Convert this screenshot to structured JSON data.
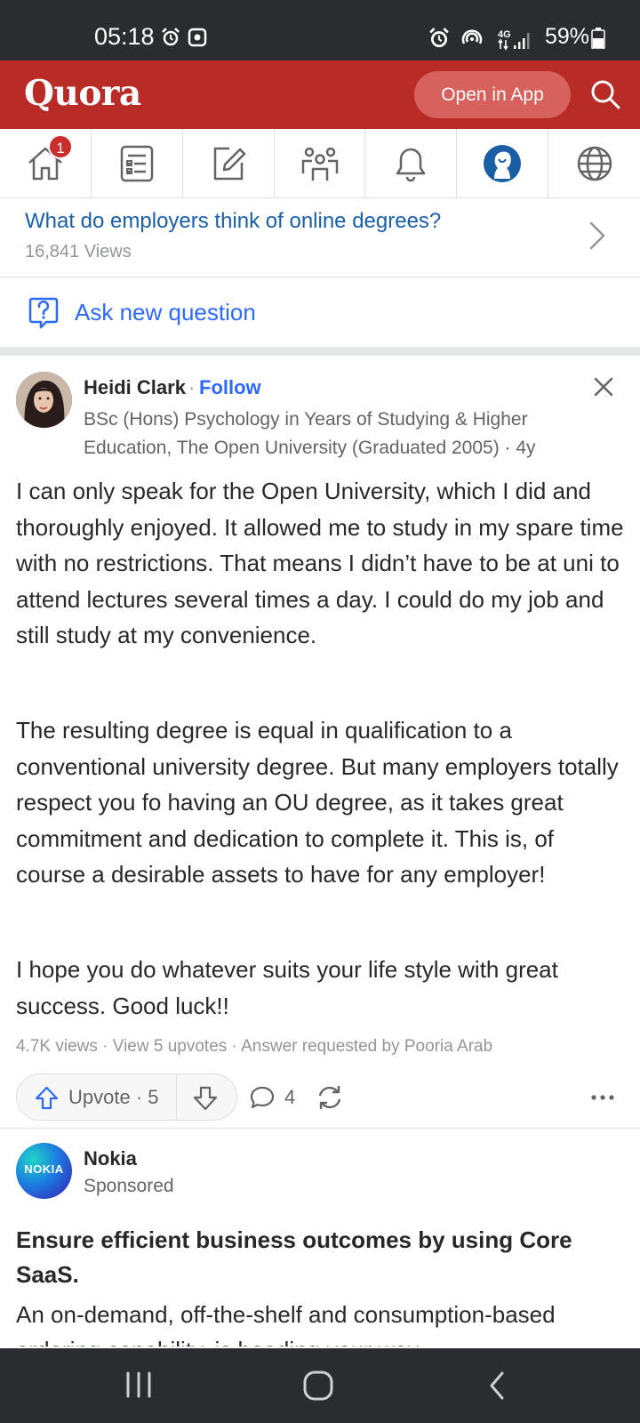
{
  "status_bar": {
    "time": "05:18",
    "battery": "59%",
    "network": "4G"
  },
  "header": {
    "logo": "Quora",
    "open_in_app": "Open in App",
    "brand_color": "#b92b27"
  },
  "nav": {
    "items": [
      {
        "name": "home",
        "icon": "home-icon",
        "badge": "1"
      },
      {
        "name": "following",
        "icon": "feed-list-icon"
      },
      {
        "name": "answer",
        "icon": "edit-icon"
      },
      {
        "name": "spaces",
        "icon": "people-icon"
      },
      {
        "name": "notifications",
        "icon": "bell-icon"
      },
      {
        "name": "profile",
        "icon": "avatar-icon"
      },
      {
        "name": "languages",
        "icon": "globe-icon"
      }
    ]
  },
  "question": {
    "title": "What do employers think of online degrees?",
    "views": "16,841 Views"
  },
  "ask": {
    "label": "Ask new question"
  },
  "answer": {
    "author": "Heidi Clark",
    "separator": "·",
    "follow": "Follow",
    "credential": "BSc (Hons) Psychology in Years of Studying & Higher Education, The Open University (Graduated 2005) · 4y",
    "paragraphs": [
      "I can only speak for the Open University, which I did and thoroughly enjoyed. It allowed me to study in my spare time with no restrictions. That means I didn’t have to be at uni to attend lectures several times a day. I could do my job and still study at my convenience.",
      "The resulting degree is equal in qualification to a conventional university degree. But many employers totally respect you fo having an OU degree, as it takes great commitment and dedication to complete it. This is, of course a desirable assets to have for any employer!",
      "I hope you do whatever suits your life style with great success. Good luck!!"
    ],
    "meta": "4.7K views · View 5 upvotes · Answer requested by Pooria Arab",
    "upvote_label": "Upvote · 5",
    "comment_count": "4"
  },
  "ad": {
    "logo_text": "NOKIA",
    "name": "Nokia",
    "sponsored": "Sponsored",
    "headline": "Ensure efficient business outcomes by using Core SaaS.",
    "body": "An on-demand, off-the-shelf and consumption-based ordering capability, is heading your way."
  }
}
